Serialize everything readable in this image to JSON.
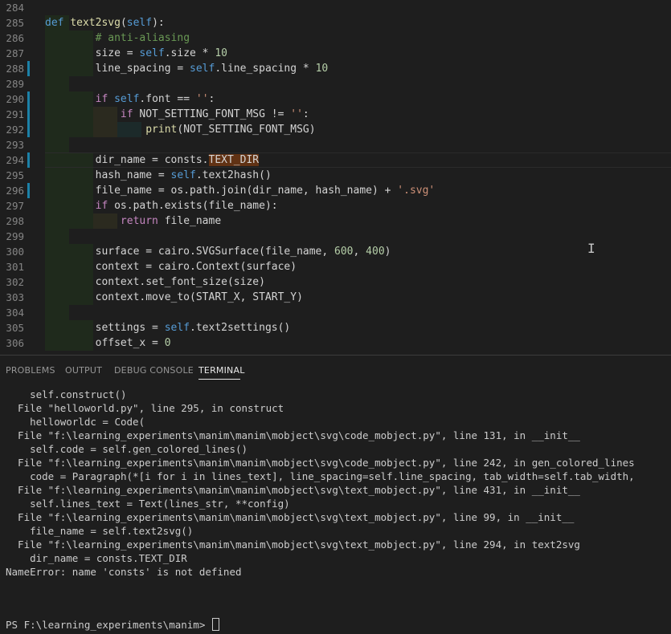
{
  "editor": {
    "lines": [
      {
        "num": "284",
        "html": ""
      },
      {
        "num": "285",
        "html": "<span class=\"k\">def</span> <span class=\"fn\">text2svg</span>(<span class=\"sf\">self</span>):"
      },
      {
        "num": "286",
        "html": "        <span class=\"cm\"># anti-aliasing</span>"
      },
      {
        "num": "287",
        "html": "        size = <span class=\"sf\">self</span>.size * <span class=\"nu\">10</span>"
      },
      {
        "num": "288",
        "html": "        line_spacing = <span class=\"sf\">self</span>.line_spacing * <span class=\"nu\">10</span>"
      },
      {
        "num": "289",
        "html": ""
      },
      {
        "num": "290",
        "html": "        <span class=\"kc\">if</span> <span class=\"sf\">self</span>.font == <span class=\"st\">''</span>:"
      },
      {
        "num": "291",
        "html": "            <span class=\"kc\">if</span> NOT_SETTING_FONT_MSG != <span class=\"st\">''</span>:"
      },
      {
        "num": "292",
        "html": "                <span class=\"fn\">print</span>(NOT_SETTING_FONT_MSG)"
      },
      {
        "num": "293",
        "html": ""
      },
      {
        "num": "294",
        "html": "        dir_name = consts.<span class=\"hl\">TEXT_DIR</span>"
      },
      {
        "num": "295",
        "html": "        hash_name = <span class=\"sf\">self</span>.text2hash()"
      },
      {
        "num": "296",
        "html": "        file_name = os.path.join(dir_name, hash_name) + <span class=\"st\">'.svg'</span>"
      },
      {
        "num": "297",
        "html": "        <span class=\"kc\">if</span> os.path.exists(file_name):"
      },
      {
        "num": "298",
        "html": "            <span class=\"kc\">return</span> file_name"
      },
      {
        "num": "299",
        "html": ""
      },
      {
        "num": "300",
        "html": "        surface = cairo.SVGSurface(file_name, <span class=\"nu\">600</span>, <span class=\"nu\">400</span>)"
      },
      {
        "num": "301",
        "html": "        context = cairo.Context(surface)"
      },
      {
        "num": "302",
        "html": "        context.set_font_size(size)"
      },
      {
        "num": "303",
        "html": "        context.move_to(START_X, START_Y)"
      },
      {
        "num": "304",
        "html": ""
      },
      {
        "num": "305",
        "html": "        settings = <span class=\"sf\">self</span>.text2settings()"
      },
      {
        "num": "306",
        "html": "        offset_x = <span class=\"nu\">0</span>"
      }
    ],
    "modified_lines": [
      "288",
      "290",
      "291",
      "292",
      "294",
      "296"
    ]
  },
  "panel": {
    "tabs": [
      {
        "label": "PROBLEMS",
        "active": false
      },
      {
        "label": "OUTPUT",
        "active": false
      },
      {
        "label": "DEBUG CONSOLE",
        "active": false
      },
      {
        "label": "TERMINAL",
        "active": true
      }
    ],
    "terminal_lines": [
      "    self.construct()",
      "  File \"helloworld.py\", line 295, in construct",
      "    helloworldc = Code(",
      "  File \"f:\\learning_experiments\\manim\\manim\\mobject\\svg\\code_mobject.py\", line 131, in __init__",
      "    self.code = self.gen_colored_lines()",
      "  File \"f:\\learning_experiments\\manim\\manim\\mobject\\svg\\code_mobject.py\", line 242, in gen_colored_lines",
      "    code = Paragraph(*[i for i in lines_text], line_spacing=self.line_spacing, tab_width=self.tab_width,",
      "  File \"f:\\learning_experiments\\manim\\manim\\mobject\\svg\\text_mobject.py\", line 431, in __init__",
      "    self.lines_text = Text(lines_str, **config)",
      "  File \"f:\\learning_experiments\\manim\\manim\\mobject\\svg\\text_mobject.py\", line 99, in __init__",
      "    file_name = self.text2svg()",
      "  File \"f:\\learning_experiments\\manim\\manim\\mobject\\svg\\text_mobject.py\", line 294, in text2svg",
      "    dir_name = consts.TEXT_DIR",
      "NameError: name 'consts' is not defined"
    ],
    "prompt": "PS F:\\learning_experiments\\manim> "
  }
}
